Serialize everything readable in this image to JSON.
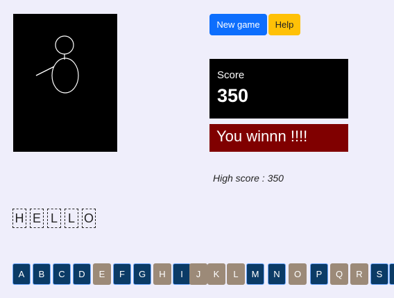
{
  "controls": {
    "new_game_label": "New game",
    "help_label": "Help"
  },
  "score": {
    "label": "Score",
    "value": "350"
  },
  "result_message": "You winnn !!!!",
  "high_score_text": "High score : 350",
  "word_letters": [
    "H",
    "E",
    "L",
    "L",
    "O"
  ],
  "keyboard": [
    {
      "letter": "A",
      "state": "available"
    },
    {
      "letter": "B",
      "state": "available"
    },
    {
      "letter": "C",
      "state": "available"
    },
    {
      "letter": "D",
      "state": "available"
    },
    {
      "letter": "E",
      "state": "used"
    },
    {
      "letter": "F",
      "state": "available"
    },
    {
      "letter": "G",
      "state": "available"
    },
    {
      "letter": "H",
      "state": "used"
    },
    {
      "letter": "I",
      "state": "available"
    },
    {
      "letter": "J",
      "state": "used"
    },
    {
      "letter": "K",
      "state": "used"
    },
    {
      "letter": "L",
      "state": "used"
    },
    {
      "letter": "M",
      "state": "available"
    },
    {
      "letter": "N",
      "state": "available"
    },
    {
      "letter": "O",
      "state": "used"
    },
    {
      "letter": "P",
      "state": "available"
    },
    {
      "letter": "Q",
      "state": "used"
    },
    {
      "letter": "R",
      "state": "used"
    },
    {
      "letter": "S",
      "state": "available"
    }
  ],
  "colors": {
    "key_available": "#0b3b66",
    "key_used": "#9c8a78",
    "win_background": "#800000",
    "new_game_button": "#0d6efd",
    "help_button": "#ffc107"
  }
}
